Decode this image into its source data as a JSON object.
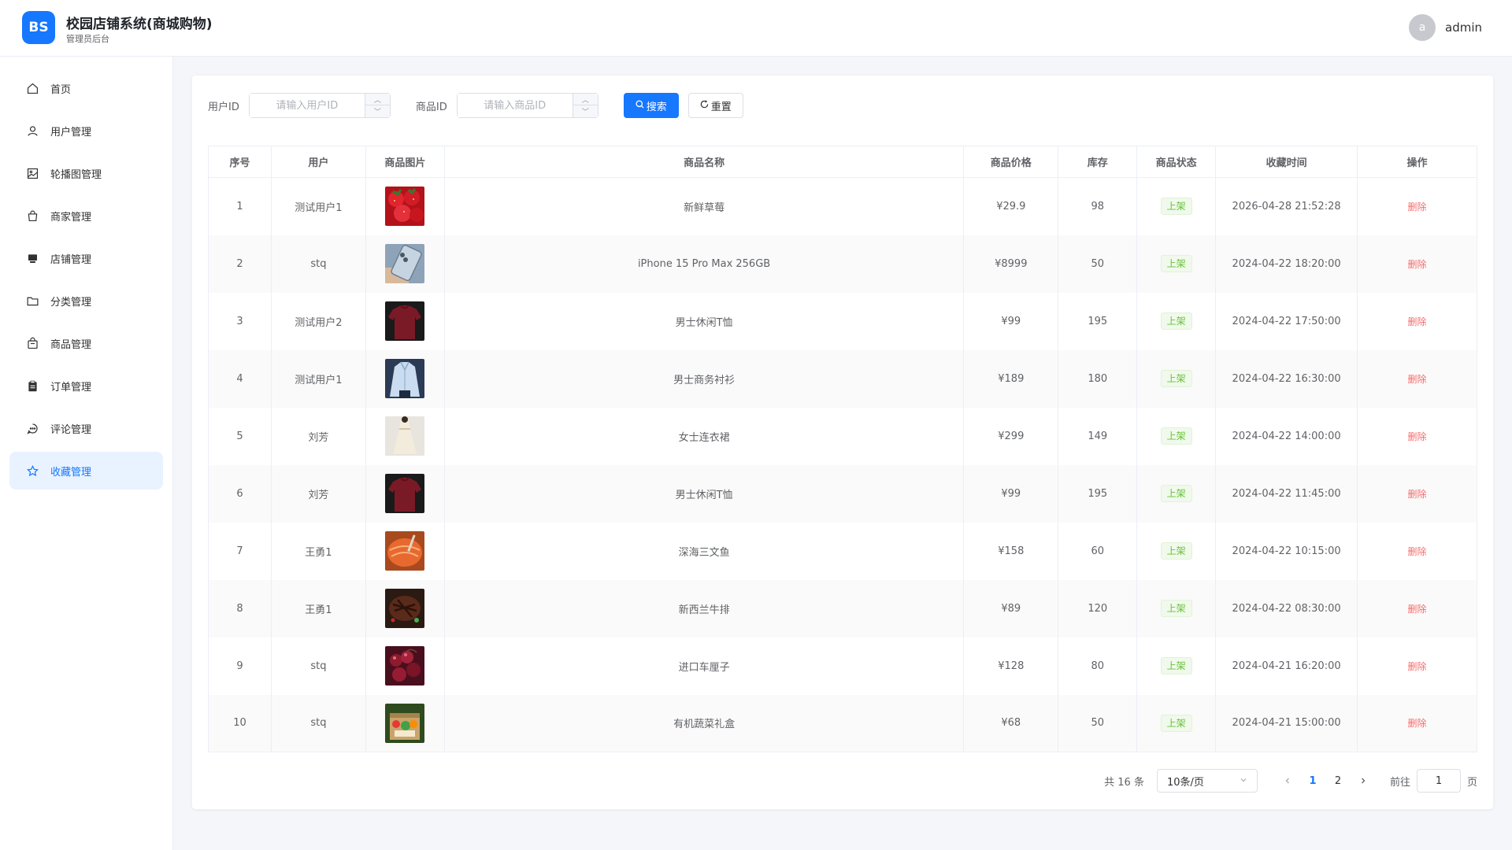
{
  "header": {
    "logo_text": "BS",
    "title": "校园店铺系统(商城购物)",
    "subtitle": "管理员后台",
    "avatar_letter": "a",
    "username": "admin"
  },
  "sidebar": {
    "items": [
      {
        "label": "首页",
        "icon": "home-icon",
        "active": false
      },
      {
        "label": "用户管理",
        "icon": "user-icon",
        "active": false
      },
      {
        "label": "轮播图管理",
        "icon": "picture-icon",
        "active": false
      },
      {
        "label": "商家管理",
        "icon": "shopping-bag-icon",
        "active": false
      },
      {
        "label": "店铺管理",
        "icon": "shop-icon",
        "active": false
      },
      {
        "label": "分类管理",
        "icon": "folder-icon",
        "active": false
      },
      {
        "label": "商品管理",
        "icon": "goods-icon",
        "active": false
      },
      {
        "label": "订单管理",
        "icon": "clipboard-icon",
        "active": false
      },
      {
        "label": "评论管理",
        "icon": "chat-icon",
        "active": false
      },
      {
        "label": "收藏管理",
        "icon": "star-icon",
        "active": true
      }
    ]
  },
  "search": {
    "user_id_label": "用户ID",
    "user_id_placeholder": "请输入用户ID",
    "product_id_label": "商品ID",
    "product_id_placeholder": "请输入商品ID",
    "search_button": "搜索",
    "reset_button": "重置"
  },
  "table": {
    "columns": [
      "序号",
      "用户",
      "商品图片",
      "商品名称",
      "商品价格",
      "库存",
      "商品状态",
      "收藏时间",
      "操作"
    ],
    "delete_label": "删除",
    "rows": [
      {
        "index": "1",
        "user": "测试用户1",
        "image": "strawberry",
        "name": "新鲜草莓",
        "price": "¥29.9",
        "stock": "98",
        "status": "上架",
        "time": "2026-04-28 21:52:28"
      },
      {
        "index": "2",
        "user": "stq",
        "image": "phone",
        "name": "iPhone 15 Pro Max 256GB",
        "price": "¥8999",
        "stock": "50",
        "status": "上架",
        "time": "2024-04-22 18:20:00"
      },
      {
        "index": "3",
        "user": "测试用户2",
        "image": "tshirt",
        "name": "男士休闲T恤",
        "price": "¥99",
        "stock": "195",
        "status": "上架",
        "time": "2024-04-22 17:50:00"
      },
      {
        "index": "4",
        "user": "测试用户1",
        "image": "shirt",
        "name": "男士商务衬衫",
        "price": "¥189",
        "stock": "180",
        "status": "上架",
        "time": "2024-04-22 16:30:00"
      },
      {
        "index": "5",
        "user": "刘芳",
        "image": "dress",
        "name": "女士连衣裙",
        "price": "¥299",
        "stock": "149",
        "status": "上架",
        "time": "2024-04-22 14:00:00"
      },
      {
        "index": "6",
        "user": "刘芳",
        "image": "tshirt",
        "name": "男士休闲T恤",
        "price": "¥99",
        "stock": "195",
        "status": "上架",
        "time": "2024-04-22 11:45:00"
      },
      {
        "index": "7",
        "user": "王勇1",
        "image": "salmon",
        "name": "深海三文鱼",
        "price": "¥158",
        "stock": "60",
        "status": "上架",
        "time": "2024-04-22 10:15:00"
      },
      {
        "index": "8",
        "user": "王勇1",
        "image": "steak",
        "name": "新西兰牛排",
        "price": "¥89",
        "stock": "120",
        "status": "上架",
        "time": "2024-04-22 08:30:00"
      },
      {
        "index": "9",
        "user": "stq",
        "image": "cherry",
        "name": "进口车厘子",
        "price": "¥128",
        "stock": "80",
        "status": "上架",
        "time": "2024-04-21 16:20:00"
      },
      {
        "index": "10",
        "user": "stq",
        "image": "veggiebox",
        "name": "有机蔬菜礼盒",
        "price": "¥68",
        "stock": "50",
        "status": "上架",
        "time": "2024-04-21 15:00:00"
      }
    ]
  },
  "pagination": {
    "total_text": "共 16 条",
    "page_size": "10条/页",
    "pages": [
      "1",
      "2"
    ],
    "current_page": "1",
    "goto_label": "前往",
    "goto_value": "1",
    "page_suffix": "页"
  },
  "colors": {
    "primary": "#1677ff",
    "success": "#67c23a",
    "danger": "#f56c6c"
  }
}
